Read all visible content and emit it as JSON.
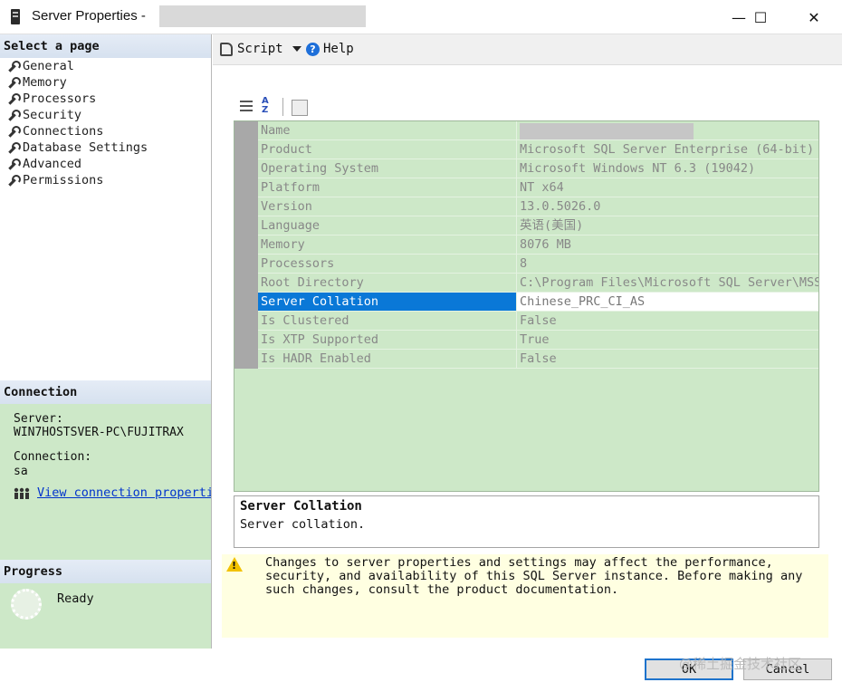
{
  "window": {
    "title": "Server Properties - ",
    "minimize_glyph": "—",
    "maximize_glyph": "☐",
    "close_glyph": "✕"
  },
  "left": {
    "select_page_header": "Select a page",
    "pages": [
      {
        "label": "General"
      },
      {
        "label": "Memory"
      },
      {
        "label": "Processors"
      },
      {
        "label": "Security"
      },
      {
        "label": "Connections"
      },
      {
        "label": "Database Settings"
      },
      {
        "label": "Advanced"
      },
      {
        "label": "Permissions"
      }
    ],
    "connection_header": "Connection",
    "server_label": "Server:",
    "server_value": "WIN7HOSTSVER-PC\\FUJITRAX",
    "connection_label": "Connection:",
    "connection_value": "sa",
    "view_link": "View connection properties",
    "progress_header": "Progress",
    "progress_status": "Ready"
  },
  "toolbar": {
    "script_label": "Script",
    "help_label": "Help"
  },
  "grid": {
    "rows": [
      {
        "name": "Name",
        "value": "",
        "redacted": true
      },
      {
        "name": "Product",
        "value": "Microsoft SQL Server Enterprise (64-bit)"
      },
      {
        "name": "Operating System",
        "value": "Microsoft Windows NT 6.3 (19042)"
      },
      {
        "name": "Platform",
        "value": "NT x64"
      },
      {
        "name": "Version",
        "value": "13.0.5026.0"
      },
      {
        "name": "Language",
        "value": "英语(美国)"
      },
      {
        "name": "Memory",
        "value": "8076 MB"
      },
      {
        "name": "Processors",
        "value": "8"
      },
      {
        "name": "Root Directory",
        "value": "C:\\Program Files\\Microsoft SQL Server\\MSSQ"
      },
      {
        "name": "Server Collation",
        "value": "Chinese_PRC_CI_AS",
        "selected": true
      },
      {
        "name": "Is Clustered",
        "value": "False"
      },
      {
        "name": "Is XTP Supported",
        "value": "True"
      },
      {
        "name": "Is HADR Enabled",
        "value": "False"
      }
    ]
  },
  "description": {
    "title": "Server Collation",
    "text": "Server collation."
  },
  "warning": {
    "text": "Changes to server properties and settings may affect the performance, security, and availability of this SQL Server instance. Before making any such changes, consult the product documentation."
  },
  "buttons": {
    "ok": "OK",
    "cancel": "Cancel"
  },
  "watermark": "@稀土掘金技术社区",
  "colors": {
    "panel_green": "#cde8c8",
    "selection_blue": "#0a78d7",
    "warning_bg": "#ffffe1",
    "link_blue": "#0033cc"
  }
}
